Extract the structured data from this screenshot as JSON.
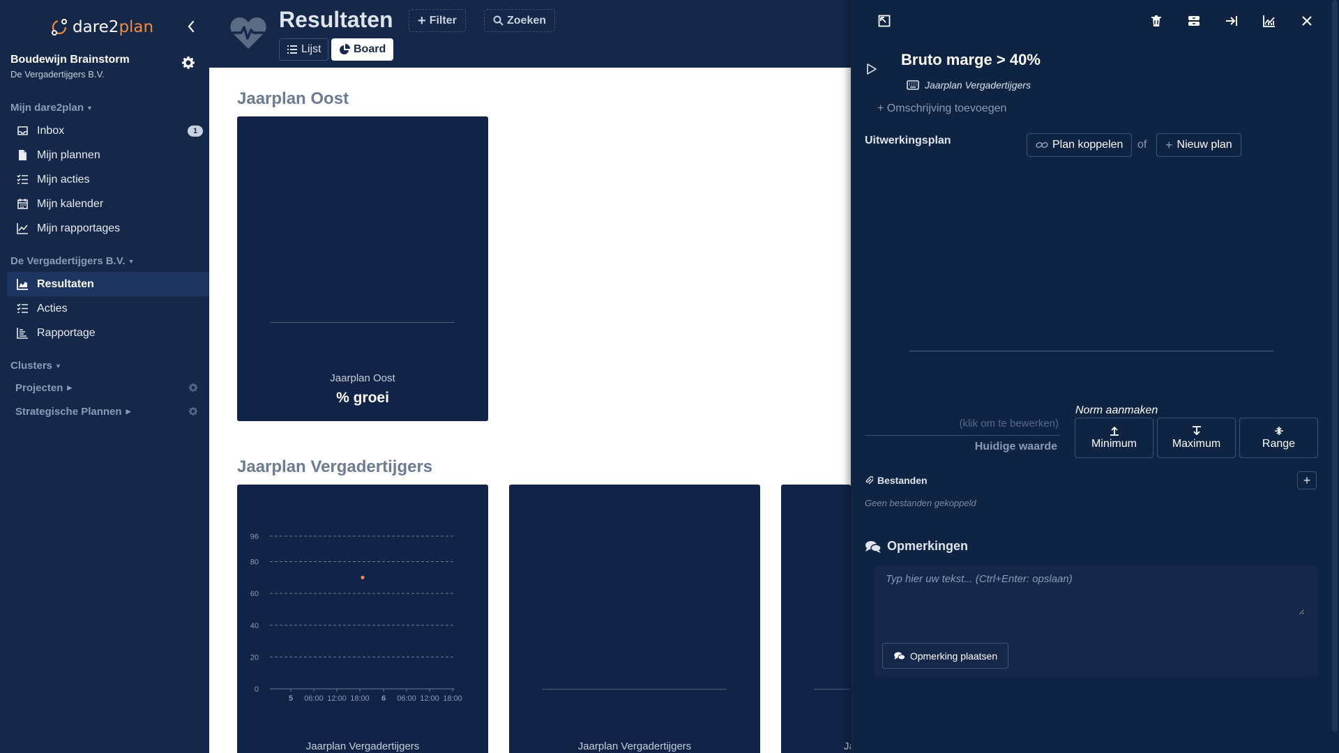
{
  "sidebar": {
    "logo_part1": "dare2",
    "logo_part2": "plan",
    "user_name": "Boudewijn Brainstorm",
    "org_name": "De Vergadertijgers B.V.",
    "section_mine": "Mijn dare2plan",
    "mine_items": [
      {
        "label": "Inbox",
        "badge": "1"
      },
      {
        "label": "Mijn plannen"
      },
      {
        "label": "Mijn acties"
      },
      {
        "label": "Mijn kalender"
      },
      {
        "label": "Mijn rapportages"
      }
    ],
    "section_org": "De Vergadertijgers B.V.",
    "org_items": [
      {
        "label": "Resultaten",
        "active": true
      },
      {
        "label": "Acties"
      },
      {
        "label": "Rapportage"
      }
    ],
    "section_clusters": "Clusters",
    "cluster_items": [
      {
        "label": "Projecten"
      },
      {
        "label": "Strategische Plannen"
      }
    ]
  },
  "header": {
    "title": "Resultaten",
    "filter_label": "Filter",
    "search_label": "Zoeken",
    "view_list_label": "Lijst",
    "view_board_label": "Board"
  },
  "board": {
    "groups": [
      {
        "title": "Jaarplan Oost",
        "cards": [
          {
            "label": "Jaarplan Oost",
            "value": "% groei"
          }
        ]
      },
      {
        "title": "Jaarplan Vergadertijgers",
        "cards": [
          {
            "label": "Jaarplan Vergadertijgers"
          },
          {
            "label": "Jaarplan Vergadertijgers"
          },
          {
            "label": "Ja"
          }
        ]
      }
    ]
  },
  "chart_data": {
    "type": "scatter",
    "x_ticks": [
      "5",
      "06:00",
      "12:00",
      "18:00",
      "6",
      "06:00",
      "12:00",
      "18:00"
    ],
    "y_ticks": [
      0,
      20,
      40,
      60,
      80,
      96
    ],
    "ylim": [
      0,
      96
    ],
    "grid": true,
    "series": [
      {
        "x": [
          "6 00:00"
        ],
        "y": [
          70
        ],
        "color": "#f08a5d"
      }
    ]
  },
  "panel": {
    "title": "Bruto marge > 40%",
    "plan_ref": "Jaarplan Vergadertijgers",
    "add_description": "Omschrijving toevoegen",
    "elaboration_label": "Uitwerkingsplan",
    "link_plan_label": "Plan koppelen",
    "or_text": "of",
    "new_plan_label": "Nieuw plan",
    "edit_hint": "(klik om te bewerken)",
    "current_value_label": "Huidige waarde",
    "norm_label": "Norm aanmaken",
    "norm_min": "Minimum",
    "norm_max": "Maximum",
    "norm_range": "Range",
    "files_label": "Bestanden",
    "no_files": "Geen bestanden gekoppeld",
    "comments_label": "Opmerkingen",
    "comment_placeholder": "Typ hier uw tekst... (Ctrl+Enter: opslaan)",
    "comment_button": "Opmerking plaatsen"
  },
  "colors": {
    "sidebar_bg": "#15284a",
    "card_bg": "#112448",
    "panel_bg": "#0f2343",
    "accent_orange": "#f08a3c",
    "point_color": "#f08a5d"
  }
}
